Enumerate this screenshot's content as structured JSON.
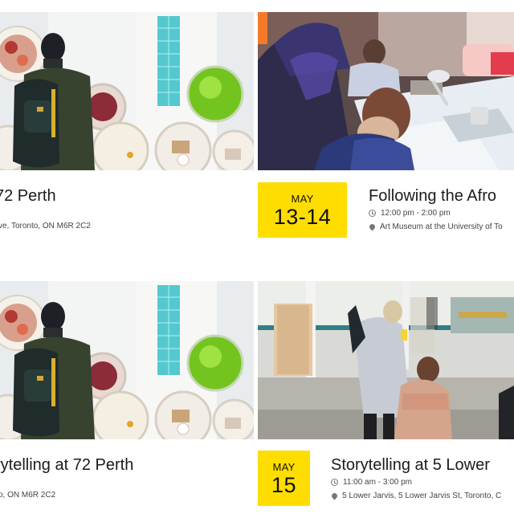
{
  "events": [
    {
      "title": "72 Perth",
      "location": "ve, Toronto, ON M6R 2C2"
    },
    {
      "month": "MAY",
      "day": "13-14",
      "title": "Following the Afro",
      "time": "12:00 pm - 2:00 pm",
      "location": "Art Museum at the University of To"
    },
    {
      "title": "rytelling at 72 Perth",
      "location": "o, ON M6R 2C2"
    },
    {
      "month": "MAY",
      "day": "15",
      "title": "Storytelling at 5 Lower",
      "time": "11:00 am - 3:00 pm",
      "location": "5 Lower Jarvis, 5 Lower Jarvis St, Toronto, C"
    }
  ],
  "colors": {
    "date_badge": "#ffdd00",
    "text": "#1e1e1e",
    "meta_text": "#444444"
  },
  "icons": {
    "time": "clock-icon",
    "location": "location-pin-icon"
  }
}
